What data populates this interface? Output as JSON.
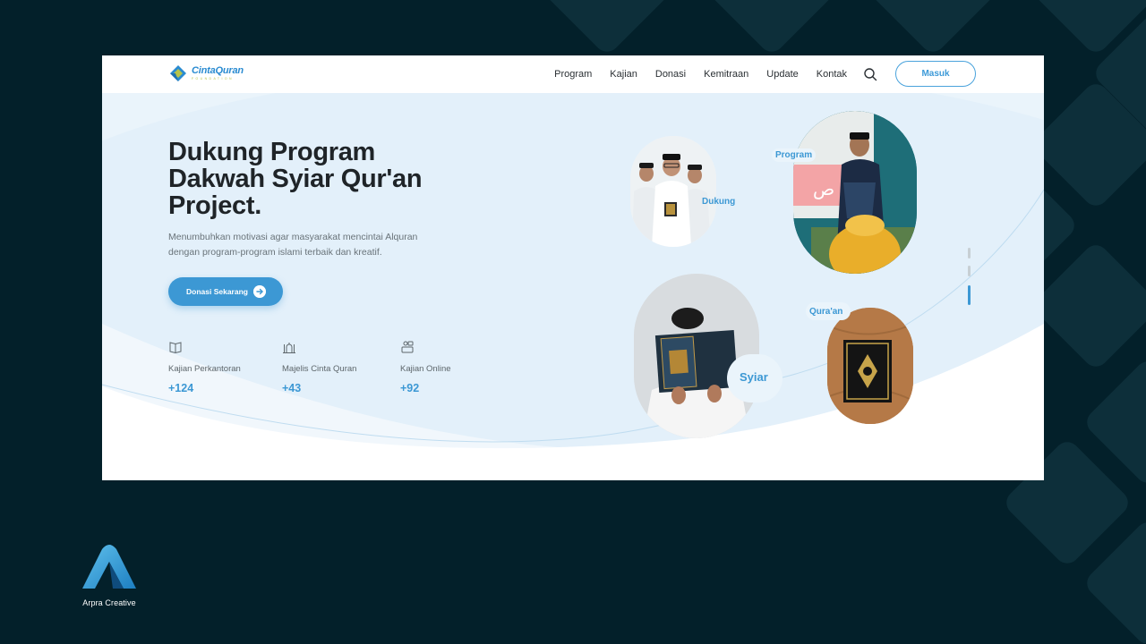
{
  "navbar": {
    "logo_name": "CintaQuran",
    "logo_sub": "FOUNDATION",
    "items": [
      {
        "label": "Program"
      },
      {
        "label": "Kajian"
      },
      {
        "label": "Donasi"
      },
      {
        "label": "Kemitraan"
      },
      {
        "label": "Update"
      },
      {
        "label": "Kontak"
      }
    ],
    "search_icon": "search-icon",
    "login_label": "Masuk"
  },
  "hero": {
    "title_lines": [
      "Dukung Program",
      "Dakwah Syiar Qur'an",
      "Project."
    ],
    "description_lines": [
      "Menumbuhkan motivasi agar masyarakat mencintai Alquran",
      "dengan program-program islami terbaik dan kreatif."
    ],
    "cta_label": "Donasi Sekarang",
    "cta_icon": "arrow-right-icon"
  },
  "stats": [
    {
      "icon": "book-icon",
      "label": "Kajian Perkantoran",
      "value": "+124"
    },
    {
      "icon": "mosque-icon",
      "label": "Majelis Cinta Quran",
      "value": "+43"
    },
    {
      "icon": "online-icon",
      "label": "Kajian Online",
      "value": "+92"
    }
  ],
  "image_labels": {
    "dukung": "Dukung",
    "program": "Program",
    "syiar": "Syiar",
    "quran": "Qura'an"
  },
  "brand": {
    "name": "Arpra Creative"
  },
  "colors": {
    "accent": "#3c98d4",
    "page_bg": "#03202a",
    "hero_bg": "#eaf4fb",
    "tile": "#0d2f3a"
  }
}
